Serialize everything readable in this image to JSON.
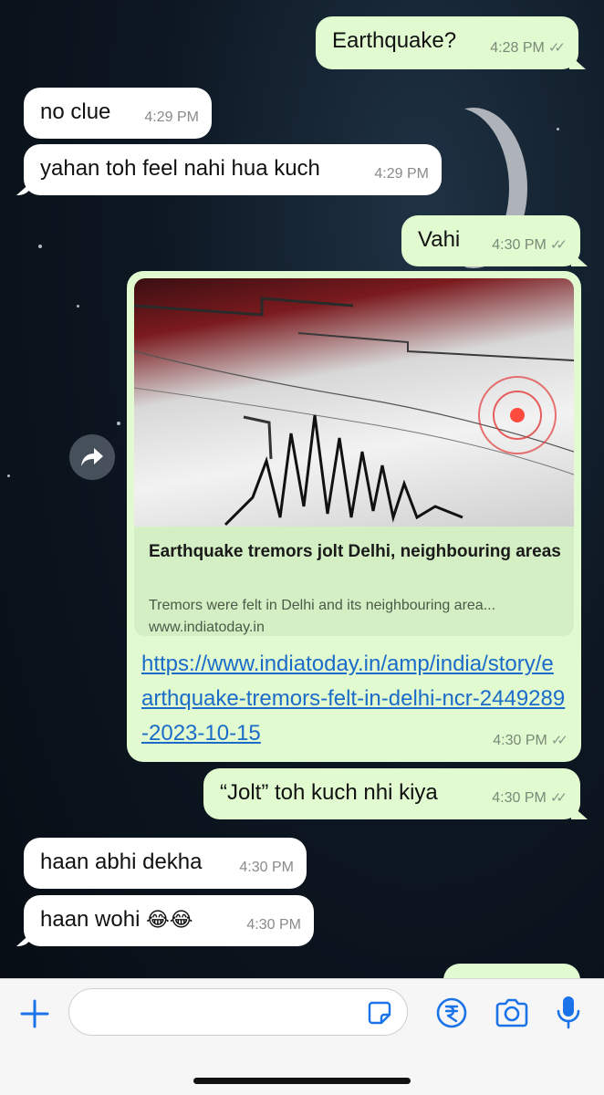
{
  "messages": [
    {
      "text": "Earthquake?",
      "time": "4:28 PM",
      "dir": "out"
    },
    {
      "text": "no clue",
      "time": "4:29 PM",
      "dir": "in"
    },
    {
      "text": "yahan toh feel nahi hua kuch",
      "time": "4:29 PM",
      "dir": "in"
    },
    {
      "text": "Vahi",
      "time": "4:30 PM",
      "dir": "out"
    },
    {
      "dir": "out",
      "time": "4:30 PM",
      "preview": {
        "title": "Earthquake tremors jolt Delhi, neighbouring areas",
        "description": "Tremors were felt in Delhi and its neighbouring area...",
        "domain": "www.indiatoday.in"
      },
      "url": "https://www.indiatoday.in/amp/india/story/earthquake-tremors-felt-in-delhi-ncr-2449289-2023-10-15"
    },
    {
      "text": "“Jolt” toh kuch nhi kiya",
      "time": "4:30 PM",
      "dir": "out"
    },
    {
      "text": "haan abhi dekha",
      "time": "4:30 PM",
      "dir": "in"
    },
    {
      "text": "haan wohi",
      "emoji": "😂😂",
      "time": "4:30 PM",
      "dir": "in"
    }
  ],
  "icons": {
    "read_receipt": "double-check-icon",
    "forward": "forward-icon",
    "add": "plus-icon",
    "sticker": "sticker-icon",
    "payment": "rupee-icon",
    "camera": "camera-icon",
    "mic": "microphone-icon"
  },
  "colors": {
    "outgoing_bubble": "#e1fad0",
    "incoming_bubble": "#ffffff",
    "link": "#1b6cc9",
    "accent": "#1a73e8"
  },
  "composer": {
    "placeholder": ""
  }
}
